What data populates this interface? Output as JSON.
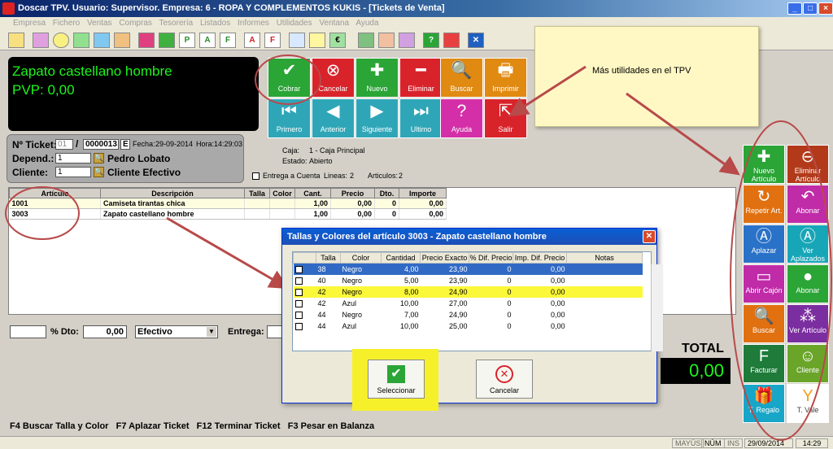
{
  "window": {
    "title": "Doscar TPV. Usuario: Supervisor. Empresa: 6 - ROPA Y COMPLEMENTOS KUKIS - [Tickets de Venta]",
    "controls": [
      "_",
      "□",
      "×"
    ]
  },
  "menu": [
    "Empresa",
    "Fichero",
    "Ventas",
    "Compras",
    "Tesorería",
    "Listados",
    "Informes",
    "Utilidades",
    "Ventana",
    "Ayuda"
  ],
  "product_display": {
    "name": "Zapato castellano hombre",
    "price": "PVP: 0,00"
  },
  "action_tiles": [
    {
      "label": "Cobrar",
      "glyph": "✔",
      "color": "#2aa536"
    },
    {
      "label": "Cancelar",
      "glyph": "⊗",
      "color": "#d9232b"
    },
    {
      "label": "Nuevo",
      "glyph": "✚",
      "color": "#2aa536"
    },
    {
      "label": "Eliminar",
      "glyph": "━",
      "color": "#d9232b"
    },
    {
      "label": "Buscar",
      "glyph": "🔍",
      "color": "#e08a12"
    },
    {
      "label": "Imprimir",
      "glyph": "🖶",
      "color": "#e08a12"
    },
    {
      "label": "Primero",
      "glyph": "⏮",
      "color": "#2fa6b8"
    },
    {
      "label": "Anterior",
      "glyph": "◀",
      "color": "#2fa6b8"
    },
    {
      "label": "Siguiente",
      "glyph": "▶",
      "color": "#2fa6b8"
    },
    {
      "label": "Ultimo",
      "glyph": "⏭",
      "color": "#2fa6b8"
    },
    {
      "label": "Ayuda",
      "glyph": "?",
      "color": "#d42fa8"
    },
    {
      "label": "Salir",
      "glyph": "⇱",
      "color": "#d9232b"
    }
  ],
  "ticket": {
    "number_label": "Nº Ticket:",
    "series": "01",
    "separator": "/",
    "number": "0000013",
    "E": "E",
    "fecha_label": "Fecha:",
    "fecha": "29-09-2014",
    "hora_label": "Hora:",
    "hora": "14:29:03",
    "depend_label": "Depend.:",
    "depend_code": "1",
    "depend_name": "Pedro Lobato",
    "cliente_label": "Cliente:",
    "cliente_code": "1",
    "cliente_name": "Cliente Efectivo"
  },
  "caja": {
    "caja_label": "Caja:",
    "caja": "1 - Caja Principal",
    "estado_label": "Estado:",
    "estado": "Abierto",
    "entrega_label": "Entrega a Cuenta",
    "lineas_label": "Lineas:",
    "lineas": "2",
    "articulos_label": "Articulos:",
    "articulos": "2"
  },
  "grid": {
    "headers": [
      "Artículo",
      "Descripción",
      "Talla",
      "Color",
      "Cant.",
      "Precio",
      "Dto.",
      "Importe"
    ],
    "rows": [
      [
        "1001",
        "Camiseta tirantas chica",
        "",
        "",
        "1,00",
        "0,00",
        "0",
        "0,00"
      ],
      [
        "3003",
        "Zapato castellano hombre",
        "",
        "",
        "1,00",
        "0,00",
        "0",
        "0,00"
      ]
    ]
  },
  "bottom": {
    "dto_label": "% Dto:",
    "dto_value": "0,00",
    "pago": "Efectivo",
    "entrega_label": "Entrega:"
  },
  "total": {
    "label": "TOTAL",
    "value": "0,00"
  },
  "side_tiles": [
    {
      "label": "Nuevo Artículo",
      "glyph": "✚",
      "color": "#2aa536"
    },
    {
      "label": "Eliminar Artículo",
      "glyph": "⊖",
      "color": "#b23a1a"
    },
    {
      "label": "Repetir Art.",
      "glyph": "↻",
      "color": "#e07010"
    },
    {
      "label": "Abonar",
      "glyph": "↶",
      "color": "#c02ba8"
    },
    {
      "label": "Aplazar",
      "glyph": "Ⓐ",
      "color": "#2a72c8"
    },
    {
      "label": "Ver Aplazados",
      "glyph": "Ⓐ",
      "color": "#17a6b8"
    },
    {
      "label": "Abrir Cajón",
      "glyph": "▭",
      "color": "#c02ba8"
    },
    {
      "label": "Abonar",
      "glyph": "●",
      "color": "#2aa536"
    },
    {
      "label": "Buscar",
      "glyph": "🔍",
      "color": "#e07010"
    },
    {
      "label": "Ver Artículo",
      "glyph": "⁂",
      "color": "#7b2ea0"
    },
    {
      "label": "Facturar",
      "glyph": "F",
      "color": "#1e7b3a"
    },
    {
      "label": "Cliente",
      "glyph": "☺",
      "color": "#6aa52a"
    },
    {
      "label": "T. Regalo",
      "glyph": "🎁",
      "color": "#17a6c8"
    },
    {
      "label": "T. Vale",
      "glyph": "Y",
      "color": "#ffffff"
    }
  ],
  "shortcuts": "F4 Buscar Talla y Color   F7 Aplazar Ticket   F12 Terminar Ticket   F3 Pesar en Balanza",
  "statusbar": {
    "mayus": "MAYÚS",
    "num": "NÚM",
    "ins": "INS",
    "date": "29/09/2014",
    "time": "14:29"
  },
  "note": {
    "text": "Más utilidades en el TPV"
  },
  "dialog": {
    "title": "Tallas y Colores del artículo 3003 - Zapato castellano hombre",
    "headers": [
      "Talla",
      "Color",
      "Cantidad",
      "Precio Exacto",
      "% Dif. Precio",
      "Imp. Dif. Precio",
      "Notas"
    ],
    "rows": [
      [
        "38",
        "Negro",
        "4,00",
        "23,90",
        "0",
        "0,00",
        ""
      ],
      [
        "40",
        "Negro",
        "5,00",
        "23,90",
        "0",
        "0,00",
        ""
      ],
      [
        "42",
        "Negro",
        "8,00",
        "24,90",
        "0",
        "0,00",
        ""
      ],
      [
        "42",
        "Azul",
        "10,00",
        "27,00",
        "0",
        "0,00",
        ""
      ],
      [
        "44",
        "Negro",
        "7,00",
        "24,90",
        "0",
        "0,00",
        ""
      ],
      [
        "44",
        "Azul",
        "10,00",
        "25,00",
        "0",
        "0,00",
        ""
      ]
    ],
    "select_label": "Seleccionar",
    "cancel_label": "Cancelar"
  }
}
